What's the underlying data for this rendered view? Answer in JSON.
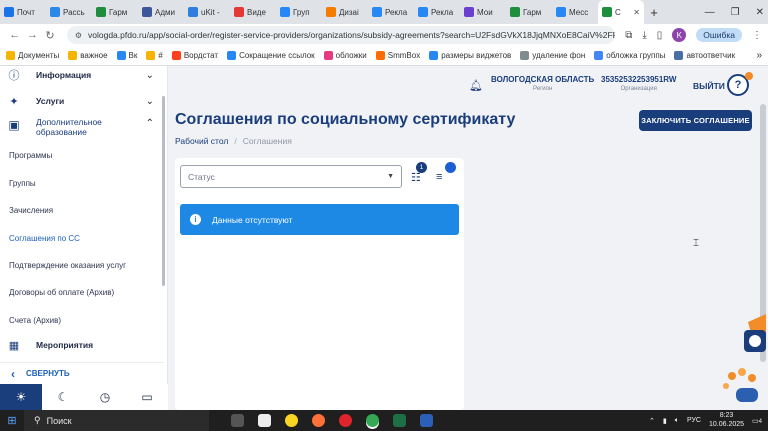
{
  "browser": {
    "tabs": [
      {
        "label": "Почт",
        "color": "#1a73e8"
      },
      {
        "label": "Рассь",
        "color": "#2b87e8"
      },
      {
        "label": "Гарм",
        "color": "#1e8e3e"
      },
      {
        "label": "Адми",
        "color": "#3b5998"
      },
      {
        "label": "uKit -",
        "color": "#2e7de0"
      },
      {
        "label": "Виде",
        "color": "#e53935"
      },
      {
        "label": "Груп",
        "color": "#2787f5"
      },
      {
        "label": "Дизаі",
        "color": "#f57c00"
      },
      {
        "label": "Рекла",
        "color": "#2787f5"
      },
      {
        "label": "Рекла",
        "color": "#2787f5"
      },
      {
        "label": "Мои",
        "color": "#6c3fd1"
      },
      {
        "label": "Гарм",
        "color": "#1e8e3e"
      },
      {
        "label": "Месс",
        "color": "#2787f5"
      },
      {
        "label": "С",
        "color": "#1e8e3e"
      }
    ],
    "url": "vologda.pfdo.ru/app/social-order/register-service-providers/organizations/subsidy-agreements?search=U2FsdGVkX18JjqMNXoE8CaiV%2FFvqY...",
    "error_button": "Ошибка",
    "profile_initial": "K",
    "bookmarks": [
      {
        "label": "Документы",
        "color": "#f4b400"
      },
      {
        "label": "важное",
        "color": "#f4b400"
      },
      {
        "label": "Вк",
        "color": "#2787f5"
      },
      {
        "label": "#",
        "color": "#f4b400"
      },
      {
        "label": "Вордстат",
        "color": "#fc3f1d"
      },
      {
        "label": "Сокращение ссылок",
        "color": "#2787f5"
      },
      {
        "label": "обложки",
        "color": "#e53980"
      },
      {
        "label": "SmmBox",
        "color": "#ff6d00"
      },
      {
        "label": "размеры виджетов",
        "color": "#2787f5"
      },
      {
        "label": "удаление фон",
        "color": "#7f8c8d"
      },
      {
        "label": "обложка группы",
        "color": "#4285f4"
      },
      {
        "label": "автоответчик",
        "color": "#4a6fa5"
      }
    ]
  },
  "sidebar": {
    "top_items": [
      {
        "label": "Информация",
        "icon": "info-icon"
      },
      {
        "label": "Услуги",
        "icon": "services-icon"
      },
      {
        "label": "Дополнительное образование",
        "icon": "education-icon"
      }
    ],
    "sub_items": [
      {
        "label": "Программы"
      },
      {
        "label": "Группы"
      },
      {
        "label": "Зачисления"
      },
      {
        "label": "Соглашения по СС"
      },
      {
        "label": "Подтверждение оказания услуг"
      },
      {
        "label": "Договоры об оплате (Архив)"
      },
      {
        "label": "Счета (Архив)"
      }
    ],
    "events_label": "Мероприятия",
    "collapse_label": "СВЕРНУТЬ"
  },
  "header": {
    "region_value": "ВОЛОГОДСКАЯ ОБЛАСТЬ",
    "region_caption": "Регион",
    "org_value": "35352532253951RW",
    "org_caption": "Организация",
    "logout": "ВЫЙТИ",
    "help": "?"
  },
  "main": {
    "title": "Соглашения по социальному сертификату",
    "breadcrumb": [
      "Рабочий стол",
      "/",
      "Соглашения"
    ],
    "primary_button": "ЗАКЛЮЧИТЬ СОГЛАШЕНИЕ",
    "status_placeholder": "Статус",
    "filter_badge": "1",
    "empty_message": "Данные отсутствуют"
  },
  "taskbar": {
    "search": "Поиск",
    "lang": "РУС",
    "time": "8:23",
    "date": "10.06.2025",
    "notif_count": "4"
  }
}
